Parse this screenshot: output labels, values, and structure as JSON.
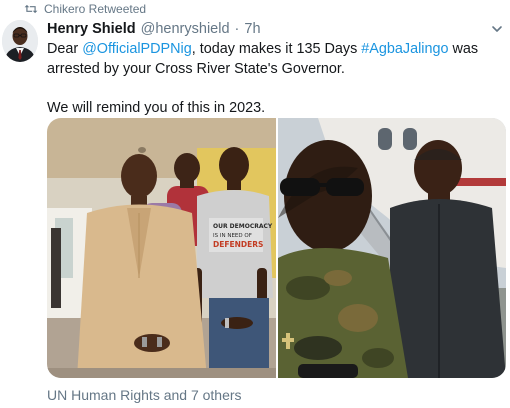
{
  "retweet": {
    "label": "Chikero Retweeted",
    "icon": "retweet-icon"
  },
  "author": {
    "display_name": "Henry Shield",
    "handle": "@henryshield",
    "separator": "·",
    "time": "7h"
  },
  "tweet": {
    "prefix": "Dear ",
    "mention": "@OfficialPDPNig",
    "mid_text": ", today makes it 135 Days ",
    "hashtag": "#AgbaJalingo",
    "rest_text": " was arrested by your Cross River State's Governor.",
    "second_paragraph": "We will remind you of this in 2023."
  },
  "media": {
    "shirt_text_line1": "OUR DEMOCRACY",
    "shirt_text_line2": "IS IN NEED OF",
    "shirt_text_line3": "DEFENDERS"
  },
  "footer": {
    "liked_by": "UN Human Rights and 7 others"
  },
  "colors": {
    "link": "#1b95e0",
    "secondary_text": "#657786",
    "primary_text": "#14171a"
  }
}
